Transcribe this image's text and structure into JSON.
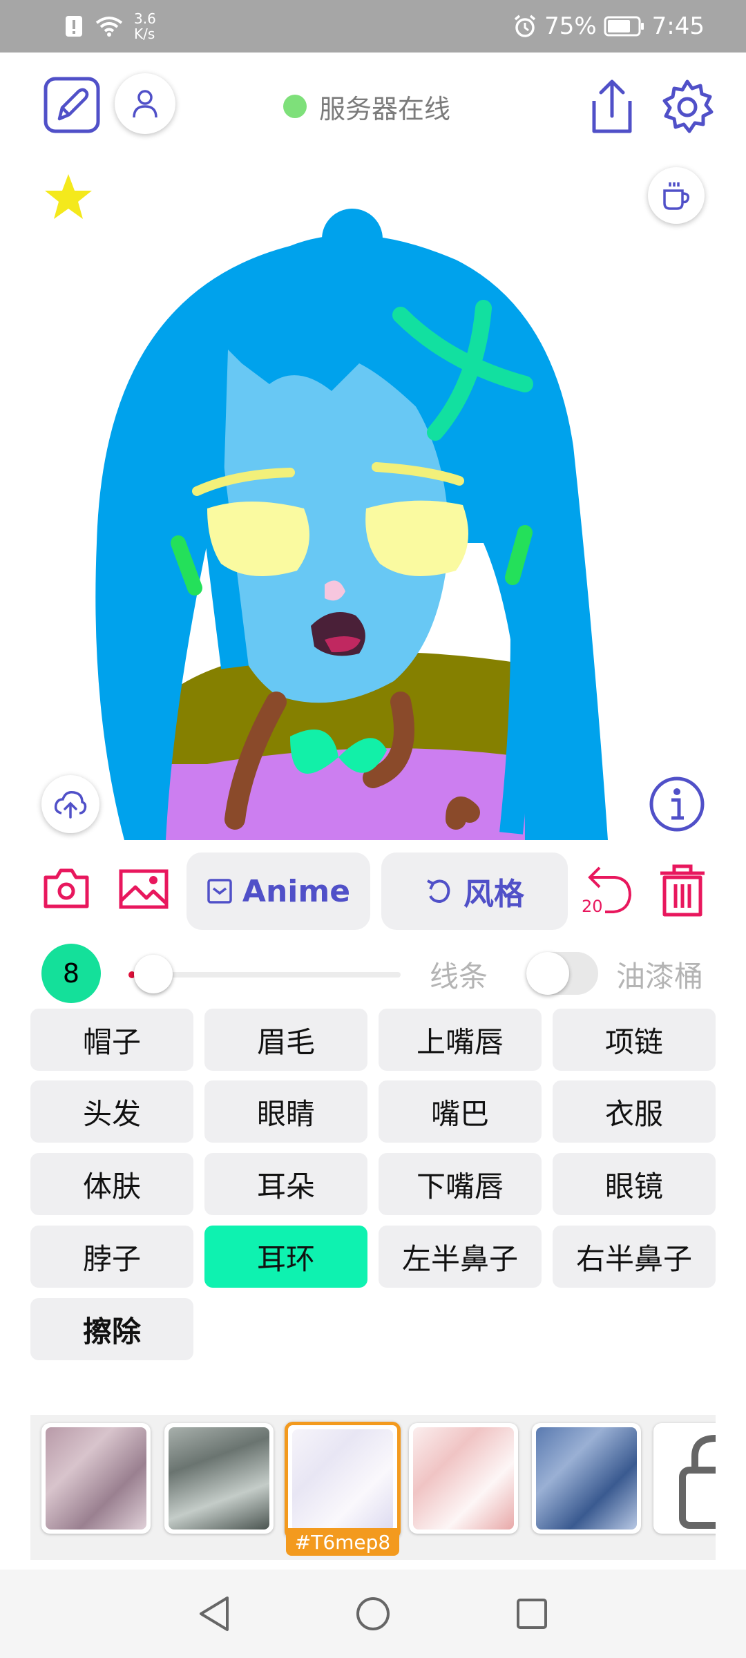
{
  "status_bar": {
    "net_speed_value": "3.6",
    "net_speed_unit": "K/s",
    "battery": "75%",
    "time": "7:45"
  },
  "toolbar": {
    "server_status": "服务器在线"
  },
  "tools": {
    "model_label": "Anime",
    "style_label": "风格",
    "undo_count": "20"
  },
  "brush": {
    "size": "8",
    "line_label": "线条",
    "bucket_label": "油漆桶",
    "bucket_on": false
  },
  "parts": [
    [
      "帽子",
      "眉毛",
      "上嘴唇",
      "项链"
    ],
    [
      "头发",
      "眼睛",
      "嘴巴",
      "衣服"
    ],
    [
      "体肤",
      "耳朵",
      "下嘴唇",
      "眼镜"
    ],
    [
      "脖子",
      "耳环",
      "左半鼻子",
      "右半鼻子"
    ],
    [
      "擦除"
    ]
  ],
  "active_part": "耳环",
  "styles": {
    "selected_tag": "#T6mep8"
  },
  "colors": {
    "accent": "#5050c8",
    "danger": "#e8175d",
    "active_part": "#0ef2b0",
    "server_online": "#7ee07a",
    "selected_style": "#f39a1e"
  }
}
